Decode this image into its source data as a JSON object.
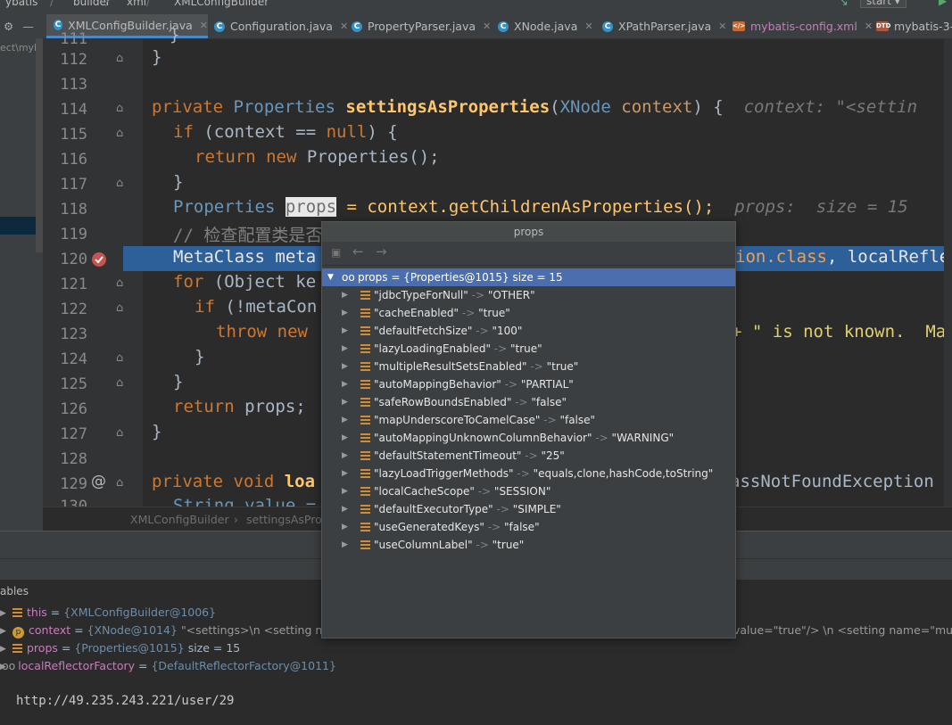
{
  "breadcrumb_top": [
    "ybatis",
    "builder",
    "xml",
    "XMLConfigBuilder"
  ],
  "run_config": "start",
  "tabs": [
    {
      "label": "XMLConfigBuilder.java",
      "active": true,
      "icon": "java-class-icon"
    },
    {
      "label": "Configuration.java",
      "icon": "java-class-icon"
    },
    {
      "label": "PropertyParser.java",
      "icon": "java-class-icon"
    },
    {
      "label": "XNode.java",
      "icon": "java-class-icon"
    },
    {
      "label": "XPathParser.java",
      "icon": "java-class-icon"
    },
    {
      "label": "mybatis-config.xml",
      "icon": "xml-file-icon"
    },
    {
      "label": "mybatis-3-c",
      "icon": "dtd-file-icon"
    }
  ],
  "project_path": "ect\\myba",
  "line_numbers": [
    "111",
    "112",
    "113",
    "114",
    "115",
    "116",
    "117",
    "118",
    "119",
    "120",
    "121",
    "122",
    "123",
    "124",
    "125",
    "126",
    "127",
    "128",
    "129",
    "130"
  ],
  "code": {
    "l111": "}",
    "l112": "}",
    "l114_kw": "private",
    "l114_type": "Properties",
    "l114_fn": "settingsAsProperties",
    "l114_param_type": "XNode",
    "l114_param": "context",
    "l114_rest": ") {",
    "l114_hint": "context: \"<settin",
    "l115_if": "if",
    "l115_rest": " (context == ",
    "l115_null": "null",
    "l115_end": ") {",
    "l116_return": "return",
    "l116_new": "new",
    "l116_rest": "Properties();",
    "l117": "}",
    "l118_type": "Properties",
    "l118_var": "props",
    "l118_rest": " = context.getChildrenAsProperties();",
    "l118_hint": "props:  size = 15",
    "l119": "// 检查配置类是否",
    "l120_a": "MetaClass meta",
    "l120_b": "ion.class",
    "l120_c": ", localRefle",
    "l121_for": "for",
    "l121_rest": " (Object ke",
    "l122_if": "if",
    "l122_rest": " (!metaCon",
    "l123_throw": "throw",
    "l123_new": "new",
    "l123_str": "+ \" is not known.  Ma",
    "l124": "}",
    "l125": "}",
    "l126_return": "return",
    "l126_rest": " props;",
    "l127": "}",
    "l129_kw": "private void",
    "l129_fn": "loa",
    "l129_rest": "assNotFoundException",
    "l130": "String value ="
  },
  "editor_breadcrumb": [
    "XMLConfigBuilder",
    "settingsAsProp"
  ],
  "popup": {
    "title": "props",
    "root_label": "props = {Properties@1015}  size = 15",
    "entries": [
      {
        "key": "\"jdbcTypeForNull\"",
        "value": "\"OTHER\""
      },
      {
        "key": "\"cacheEnabled\"",
        "value": "\"true\""
      },
      {
        "key": "\"defaultFetchSize\"",
        "value": "\"100\""
      },
      {
        "key": "\"lazyLoadingEnabled\"",
        "value": "\"true\""
      },
      {
        "key": "\"multipleResultSetsEnabled\"",
        "value": "\"true\""
      },
      {
        "key": "\"autoMappingBehavior\"",
        "value": "\"PARTIAL\""
      },
      {
        "key": "\"safeRowBoundsEnabled\"",
        "value": "\"false\""
      },
      {
        "key": "\"mapUnderscoreToCamelCase\"",
        "value": "\"false\""
      },
      {
        "key": "\"autoMappingUnknownColumnBehavior\"",
        "value": "\"WARNING\""
      },
      {
        "key": "\"defaultStatementTimeout\"",
        "value": "\"25\""
      },
      {
        "key": "\"lazyLoadTriggerMethods\"",
        "value": "\"equals,clone,hashCode,toString\""
      },
      {
        "key": "\"localCacheScope\"",
        "value": "\"SESSION\""
      },
      {
        "key": "\"defaultExecutorType\"",
        "value": "\"SIMPLE\""
      },
      {
        "key": "\"useGeneratedKeys\"",
        "value": "\"false\""
      },
      {
        "key": "\"useColumnLabel\"",
        "value": "\"true\""
      }
    ]
  },
  "variables_header": "ables",
  "variables": [
    {
      "name": "this",
      "value": "{XMLConfigBuilder@1006}"
    },
    {
      "name": "context",
      "value": "{XNode@1014}",
      "extra": "\"<settings>\\n    <setting name",
      "extra2": "value=\"true\"/>    \\n    <setting name=\"mu"
    },
    {
      "name": "props",
      "value": "{Properties@1015}",
      "extra": " size = 15"
    },
    {
      "name": "localReflectorFactory",
      "value": "{DefaultReflectorFactory@1011}"
    }
  ],
  "watermark_url": "http://49.235.243.221/user/29"
}
